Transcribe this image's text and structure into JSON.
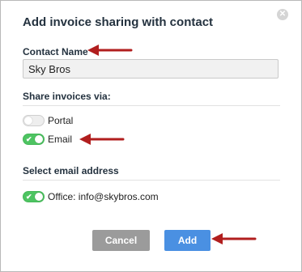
{
  "dialog": {
    "title": "Add invoice sharing with contact",
    "close_glyph": "✕"
  },
  "contact": {
    "label": "Contact Name",
    "value": "Sky Bros"
  },
  "share": {
    "label": "Share invoices via:",
    "options": [
      {
        "label": "Portal",
        "enabled": false
      },
      {
        "label": "Email",
        "enabled": true
      }
    ]
  },
  "email": {
    "label": "Select email address",
    "options": [
      {
        "label": "Office: info@skybros.com",
        "enabled": true
      }
    ]
  },
  "buttons": {
    "cancel": "Cancel",
    "add": "Add"
  },
  "colors": {
    "toggle_on": "#4ec462",
    "add_button": "#4a90e2",
    "cancel_button": "#9b9b9b",
    "annotation_arrow": "#b11e1e"
  },
  "icons": {
    "close": "close-icon",
    "check": "checkmark-icon",
    "annotation": "arrow-left-icon"
  }
}
